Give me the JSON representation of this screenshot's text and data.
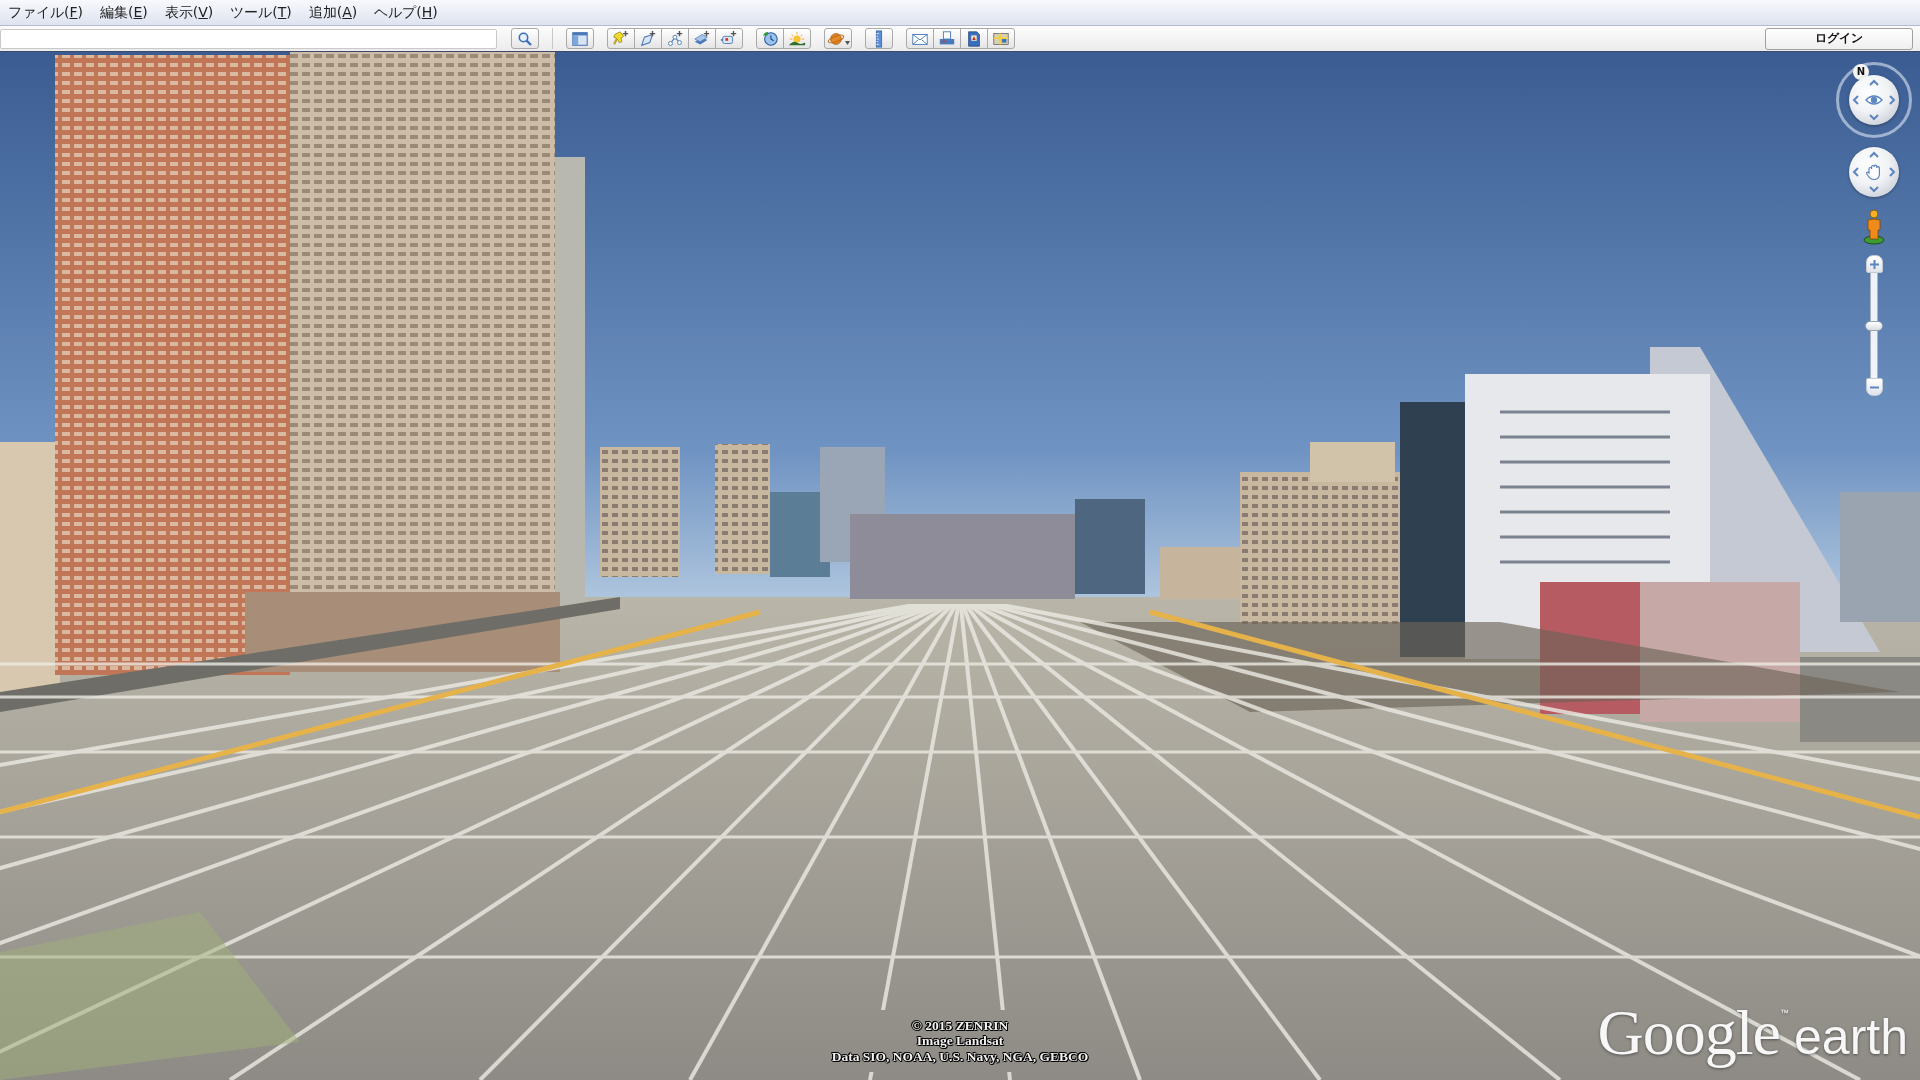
{
  "menu_bar": [
    {
      "prefix": "ファイル(",
      "accesskey": "F",
      "suffix": ")"
    },
    {
      "prefix": "編集(",
      "accesskey": "E",
      "suffix": ")"
    },
    {
      "prefix": "表示(",
      "accesskey": "V",
      "suffix": ")"
    },
    {
      "prefix": "ツール(",
      "accesskey": "T",
      "suffix": ")"
    },
    {
      "prefix": "追加(",
      "accesskey": "A",
      "suffix": ")"
    },
    {
      "prefix": "ヘルプ(",
      "accesskey": "H",
      "suffix": ")"
    }
  ],
  "toolbar": {
    "login_button": "ログイン"
  },
  "navigation": {
    "north_label": "N",
    "zoom_slider": {
      "level": 0.5
    }
  },
  "attribution": [
    "© 2015 ZENRIN",
    "Image Landsat",
    "Data SIO, NOAA, U.S. Navy, NGA, GEBCO"
  ],
  "logo": {
    "brand": "Google",
    "trademark": "™",
    "product": "earth"
  }
}
